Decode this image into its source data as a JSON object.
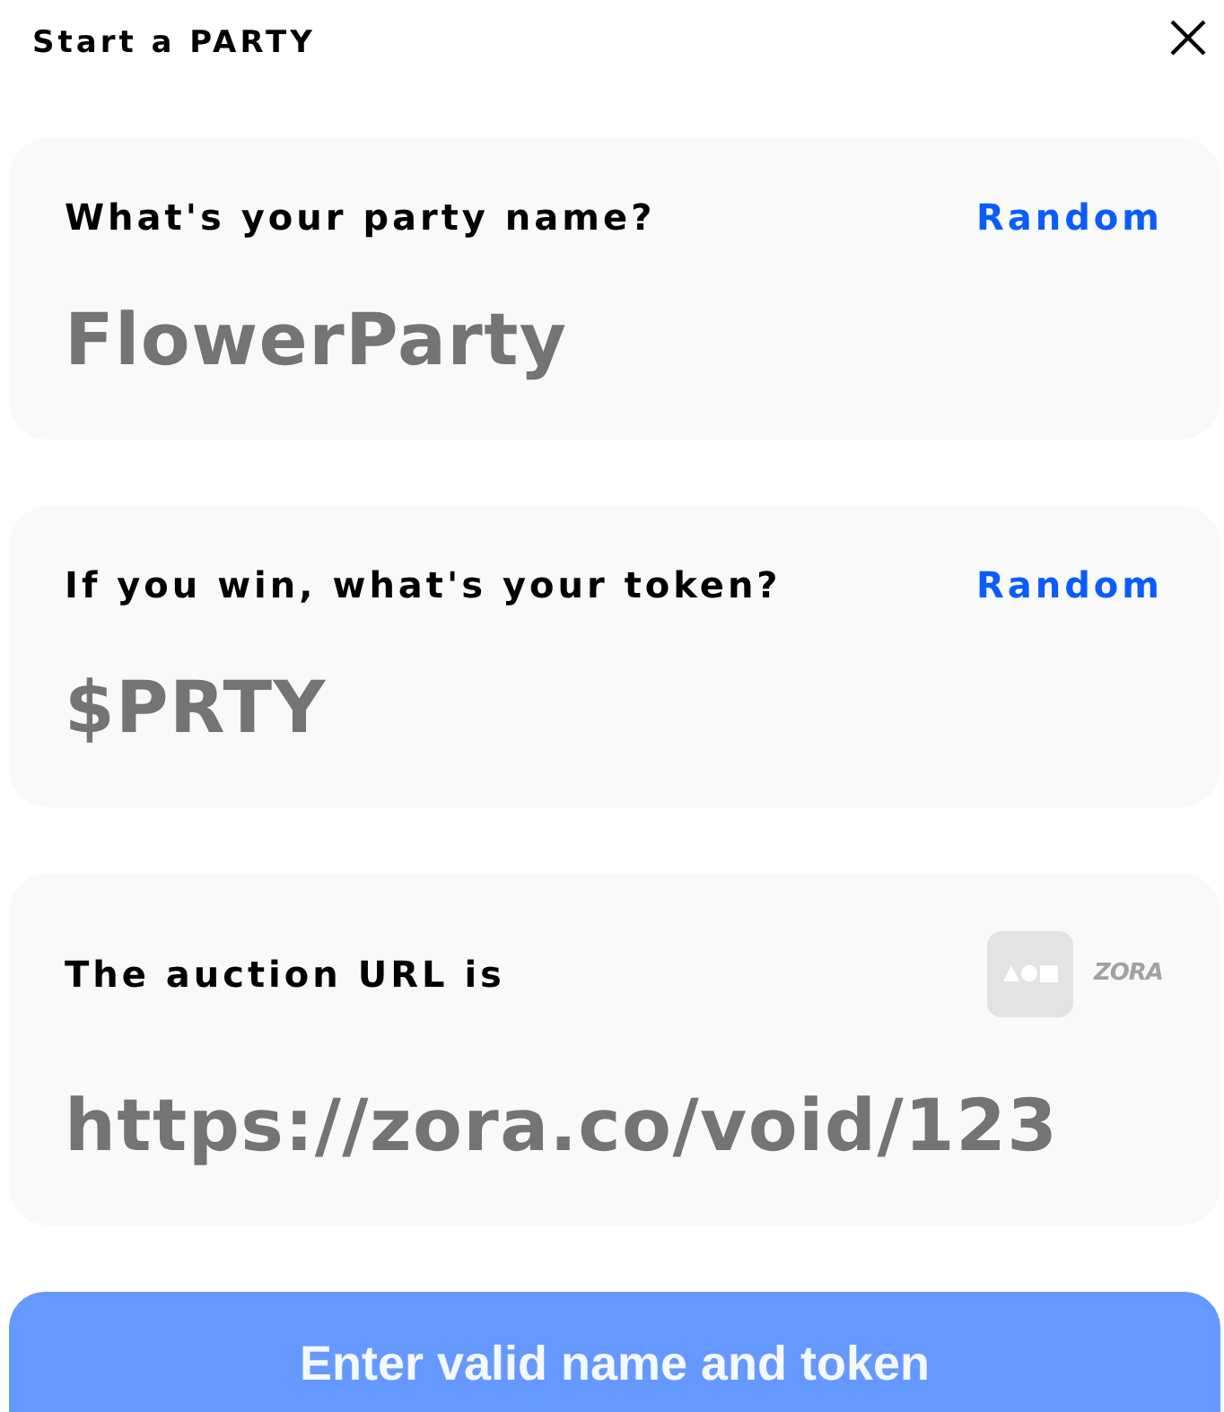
{
  "dialog": {
    "title": "Start a PARTY"
  },
  "fields": [
    {
      "kind": "action",
      "label": "What's your party name?",
      "action": "Random",
      "placeholder": "FlowerParty"
    },
    {
      "kind": "action",
      "label": "If you win, what's your token?",
      "action": "Random",
      "placeholder": "$PRTY"
    },
    {
      "kind": "logos",
      "label": "The auction URL is",
      "logo_text": "ZORA",
      "placeholder": "https://zora.co/void/123"
    }
  ],
  "submit": {
    "label": "Enter valid name and token",
    "disabled": true
  }
}
